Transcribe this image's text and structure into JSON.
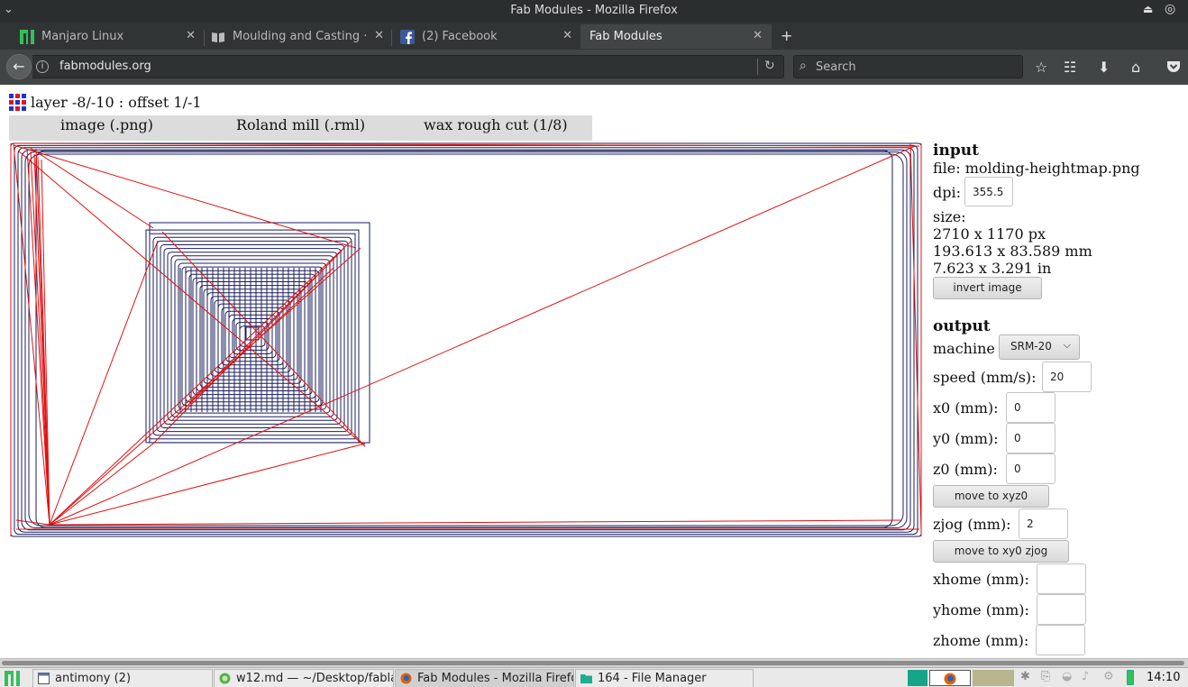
{
  "window": {
    "title": "Fab Modules - Mozilla Firefox"
  },
  "tabs": [
    {
      "label": "Manjaro Linux",
      "icon": "manjaro-icon",
      "active": false
    },
    {
      "label": "Moulding and Casting · Gi",
      "icon": "book-icon",
      "active": false
    },
    {
      "label": "(2) Facebook",
      "icon": "facebook-icon",
      "active": false
    },
    {
      "label": "Fab Modules",
      "icon": "",
      "active": true
    }
  ],
  "navbar": {
    "url": "fabmodules.org",
    "search_placeholder": "Search"
  },
  "page": {
    "layer_label": "layer -8/-10 : offset 1/-1",
    "modules": [
      "image (.png)",
      "Roland mill (.rml)",
      "wax rough cut (1/8)"
    ]
  },
  "input_panel": {
    "heading": "input",
    "file": "file: molding-heightmap.png",
    "dpi_label": "dpi:",
    "dpi_value": "355.51",
    "size_label": "size:",
    "size_px": "2710 x 1170 px",
    "size_mm": "193.613 x 83.589 mm",
    "size_in": "7.623 x 3.291 in",
    "invert_button": "invert image"
  },
  "output_panel": {
    "heading": "output",
    "machine_label": "machine",
    "machine_value": "SRM-20",
    "speed_label": "speed (mm/s):",
    "speed_value": "20",
    "x0_label": "x0 (mm):",
    "x0_value": "0",
    "y0_label": "y0 (mm):",
    "y0_value": "0",
    "z0_label": "z0 (mm):",
    "z0_value": "0",
    "move_xyz0_button": "move to xyz0",
    "zjog_label": "zjog (mm):",
    "zjog_value": "2",
    "move_xy0_zjog_button": "move to xy0 zjog",
    "xhome_label": "xhome (mm):",
    "yhome_label": "yhome (mm):",
    "zhome_label": "zhome (mm):"
  },
  "taskbar": {
    "tasks": [
      {
        "label": "antimony (2)",
        "active": false
      },
      {
        "label": "w12.md — ~/Desktop/fabla...",
        "active": false
      },
      {
        "label": "Fab Modules - Mozilla Firefox",
        "active": true
      },
      {
        "label": "164 - File Manager",
        "active": false
      }
    ],
    "clock": "14:10"
  },
  "colors": {
    "toolpath_cut": "#1a1f5c",
    "toolpath_move": "#e11010",
    "accent_green": "#35bf5c"
  }
}
